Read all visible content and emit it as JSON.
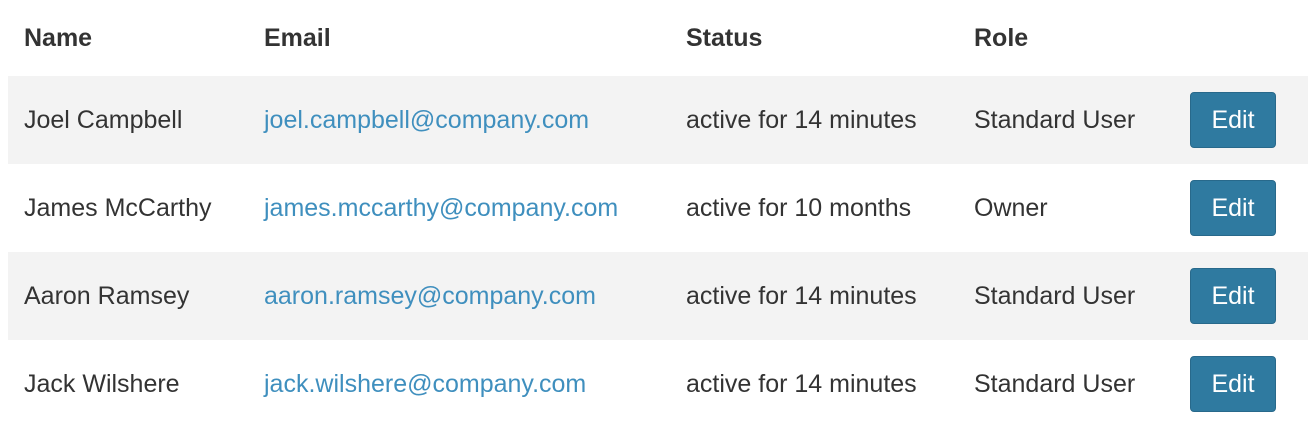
{
  "table": {
    "headers": {
      "name": "Name",
      "email": "Email",
      "status": "Status",
      "role": "Role"
    },
    "rows": [
      {
        "name": "Joel Campbell",
        "email": "joel.campbell@company.com",
        "status": "active for 14 minutes",
        "role": "Standard User",
        "action": "Edit"
      },
      {
        "name": "James McCarthy",
        "email": "james.mccarthy@company.com",
        "status": "active for 10 months",
        "role": "Owner",
        "action": "Edit"
      },
      {
        "name": "Aaron Ramsey",
        "email": "aaron.ramsey@company.com",
        "status": "active for 14 minutes",
        "role": "Standard User",
        "action": "Edit"
      },
      {
        "name": "Jack Wilshere",
        "email": "jack.wilshere@company.com",
        "status": "active for 14 minutes",
        "role": "Standard User",
        "action": "Edit"
      }
    ]
  },
  "colors": {
    "link": "#3f8fbe",
    "button": "#2f7aa0",
    "stripe": "#f3f3f3"
  }
}
